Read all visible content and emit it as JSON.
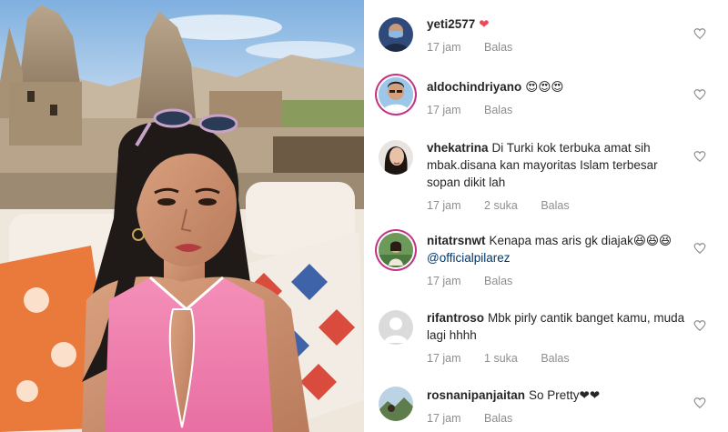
{
  "post": {
    "photo_description_icon": "selfie-photo"
  },
  "comments": [
    {
      "username": "yeti2577",
      "text": "❤",
      "time": "17 jam",
      "likes": "",
      "reply": "Balas",
      "avatar": "masked-man"
    },
    {
      "username": "aldochindriyano",
      "text": "😍😍😍",
      "time": "17 jam",
      "likes": "",
      "reply": "Balas",
      "avatar": "man-glasses"
    },
    {
      "username": "vhekatrina",
      "text": "Di Turki kok terbuka amat sih mbak.disana kan mayoritas Islam terbesar sopan dikit lah",
      "time": "17 jam",
      "likes": "2 suka",
      "reply": "Balas",
      "avatar": "woman-portrait"
    },
    {
      "username": "nitatrsnwt",
      "text": "Kenapa mas aris gk diajak😆😆😆",
      "mention": "@officialpilarez",
      "time": "17 jam",
      "likes": "",
      "reply": "Balas",
      "avatar": "woman-outdoor"
    },
    {
      "username": "rifantroso",
      "text": "Mbk pirly cantik banget kamu, muda lagi hhhh",
      "time": "17 jam",
      "likes": "1 suka",
      "reply": "Balas",
      "avatar": "default-avatar"
    },
    {
      "username": "rosnanipanjaitan",
      "text": "So Pretty❤❤",
      "time": "17 jam",
      "likes": "",
      "reply": "Balas",
      "avatar": "landscape"
    }
  ],
  "colors": {
    "text": "#262626",
    "secondary": "#8e8e8e",
    "link": "#00376b",
    "heart_red": "#ed4956",
    "story_ring": "#c13584"
  }
}
